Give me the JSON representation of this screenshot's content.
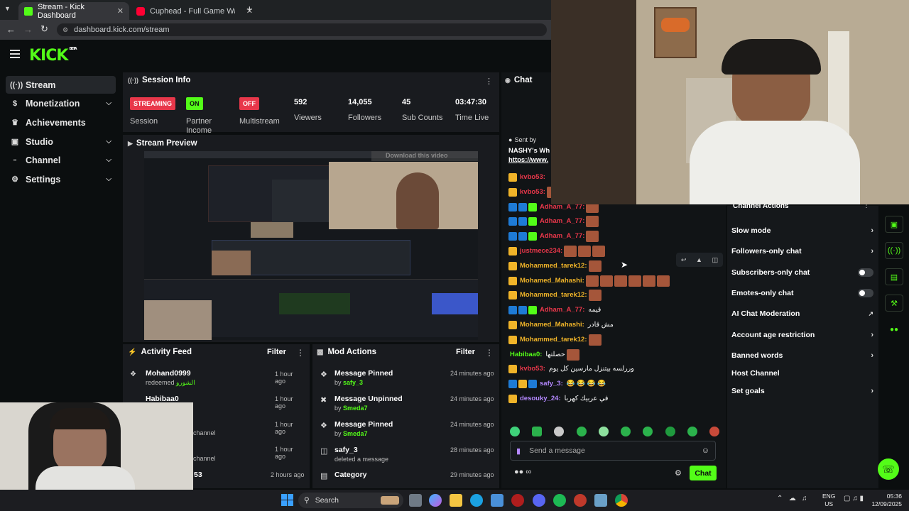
{
  "browser": {
    "tabs": [
      {
        "title": "Stream - Kick Dashboard",
        "active": true
      },
      {
        "title": "Cuphead - Full Game Walkthro",
        "active": false
      }
    ],
    "url": "dashboard.kick.com/stream"
  },
  "brand": {
    "logo": "KICK",
    "beta": "BETA",
    "accent": "#53fc18"
  },
  "sidebar": {
    "items": [
      {
        "label": "Stream",
        "icon": "stream-icon",
        "active": true
      },
      {
        "label": "Monetization",
        "icon": "dollar-icon",
        "expandable": true
      },
      {
        "label": "Achievements",
        "icon": "trophy-icon"
      },
      {
        "label": "Studio",
        "icon": "studio-icon",
        "expandable": true
      },
      {
        "label": "Channel",
        "icon": "channel-icon",
        "expandable": true
      },
      {
        "label": "Settings",
        "icon": "gear-icon",
        "expandable": true
      }
    ]
  },
  "session": {
    "title": "Session Info",
    "stats": [
      {
        "badge": "STREAMING",
        "label": "Session",
        "color": "#e8374a"
      },
      {
        "badge": "ON",
        "label": "Partner Income",
        "color": "#53fc18"
      },
      {
        "badge": "OFF",
        "label": "Multistream",
        "color": "#e8374a"
      },
      {
        "value": "592",
        "label": "Viewers"
      },
      {
        "value": "14,055",
        "label": "Followers"
      },
      {
        "value": "45",
        "label": "Sub Counts"
      },
      {
        "value": "03:47:30",
        "label": "Time Live"
      }
    ]
  },
  "preview": {
    "title": "Stream Preview",
    "overlay": "Download this video"
  },
  "activity": {
    "title": "Activity Feed",
    "filter": "Filter",
    "items": [
      {
        "user": "Mohand0999",
        "action": "redeemed",
        "reward": "الشورو",
        "time": "1 hour ago"
      },
      {
        "user": "Habibaa0",
        "action": "",
        "time": "1 hour ago"
      },
      {
        "user": "",
        "action": "channel",
        "time": "1 hour ago"
      },
      {
        "user": "",
        "action": "channel",
        "time": "1 hour ago"
      },
      {
        "user": "53",
        "action": "",
        "time": "2 hours ago"
      }
    ]
  },
  "mod": {
    "title": "Mod Actions",
    "filter": "Filter",
    "items": [
      {
        "action": "Message Pinned",
        "by": "by",
        "user": "safy_3",
        "time": "24 minutes ago",
        "icon": "pin-icon"
      },
      {
        "action": "Message Unpinned",
        "by": "by",
        "user": "Smeda7",
        "time": "24 minutes ago",
        "icon": "unpin-icon"
      },
      {
        "action": "Message Pinned",
        "by": "by",
        "user": "Smeda7",
        "time": "24 minutes ago",
        "icon": "pin-icon"
      },
      {
        "action": "safy_3",
        "by": "deleted a message",
        "user": "",
        "time": "28 minutes ago",
        "icon": "trash-icon"
      },
      {
        "action": "Category",
        "by": "",
        "user": "",
        "time": "29 minutes ago",
        "icon": "category-icon"
      }
    ]
  },
  "chat": {
    "title": "Chat",
    "pinned": {
      "sent_by": "Sent by",
      "line1": "NASHY's Wh",
      "line2": "https://www."
    },
    "messages": [
      {
        "user": "kvbo53:",
        "color": "#e8374a",
        "text": "",
        "emotes": 0
      },
      {
        "user": "kvbo53:",
        "color": "#e8374a",
        "text": "",
        "emotes": 1
      },
      {
        "user": "Adham_A_77:",
        "color": "#e8374a",
        "text": "",
        "emotes": 1
      },
      {
        "user": "Adham_A_77:",
        "color": "#e8374a",
        "text": "",
        "emotes": 1
      },
      {
        "user": "Adham_A_77:",
        "color": "#e8374a",
        "text": "",
        "emotes": 1
      },
      {
        "user": "justmece234:",
        "color": "#e8374a",
        "text": "",
        "emotes": 3
      },
      {
        "user": "Mohammed_tarek12:",
        "color": "#f0b429",
        "text": "",
        "emotes": 1
      },
      {
        "user": "Mohamed_Mahashi:",
        "color": "#f0b429",
        "text": "",
        "emotes": 6
      },
      {
        "user": "Mohammed_tarek12:",
        "color": "#f0b429",
        "text": "",
        "emotes": 1
      },
      {
        "user": "Adham_A_77:",
        "color": "#e8374a",
        "text": "قيمه",
        "emotes": 0
      },
      {
        "user": "Mohamed_Mahashi:",
        "color": "#f0b429",
        "text": "مش قادر",
        "emotes": 0
      },
      {
        "user": "Mohammed_tarek12:",
        "color": "#f0b429",
        "text": "",
        "emotes": 1
      },
      {
        "user": "Habibaa0:",
        "color": "#53fc18",
        "text": "حصلتها",
        "emotes": 1
      },
      {
        "user": "kvbo53:",
        "color": "#e8374a",
        "text": "وررلسه بيتنزل مارسين كل يوم",
        "emotes": 0
      },
      {
        "user": "safy_3:",
        "color": "#b488ff",
        "text": "😂 😂 😂 😂",
        "emotes": 0
      },
      {
        "user": "desouky_24:",
        "color": "#b488ff",
        "text": "في عربيك كهربا",
        "emotes": 0
      }
    ],
    "placeholder": "Send a message",
    "send": "Chat"
  },
  "channel_actions": {
    "title": "Channel Actions",
    "rows": [
      {
        "label": "Slow mode",
        "control": "chevron"
      },
      {
        "label": "Followers-only chat",
        "control": "chevron"
      },
      {
        "label": "Subscribers-only chat",
        "control": "toggle"
      },
      {
        "label": "Emotes-only chat",
        "control": "toggle"
      },
      {
        "label": "AI Chat Moderation",
        "control": "external"
      },
      {
        "label": "Account age restriction",
        "control": "chevron"
      },
      {
        "label": "Banned words",
        "control": "chevron"
      },
      {
        "label": "Host Channel",
        "control": "none"
      },
      {
        "label": "Set goals",
        "control": "chevron"
      }
    ]
  },
  "taskbar": {
    "search": "Search",
    "lang1": "ENG",
    "lang2": "US",
    "time": "05:36",
    "date": "12/09/2025"
  }
}
